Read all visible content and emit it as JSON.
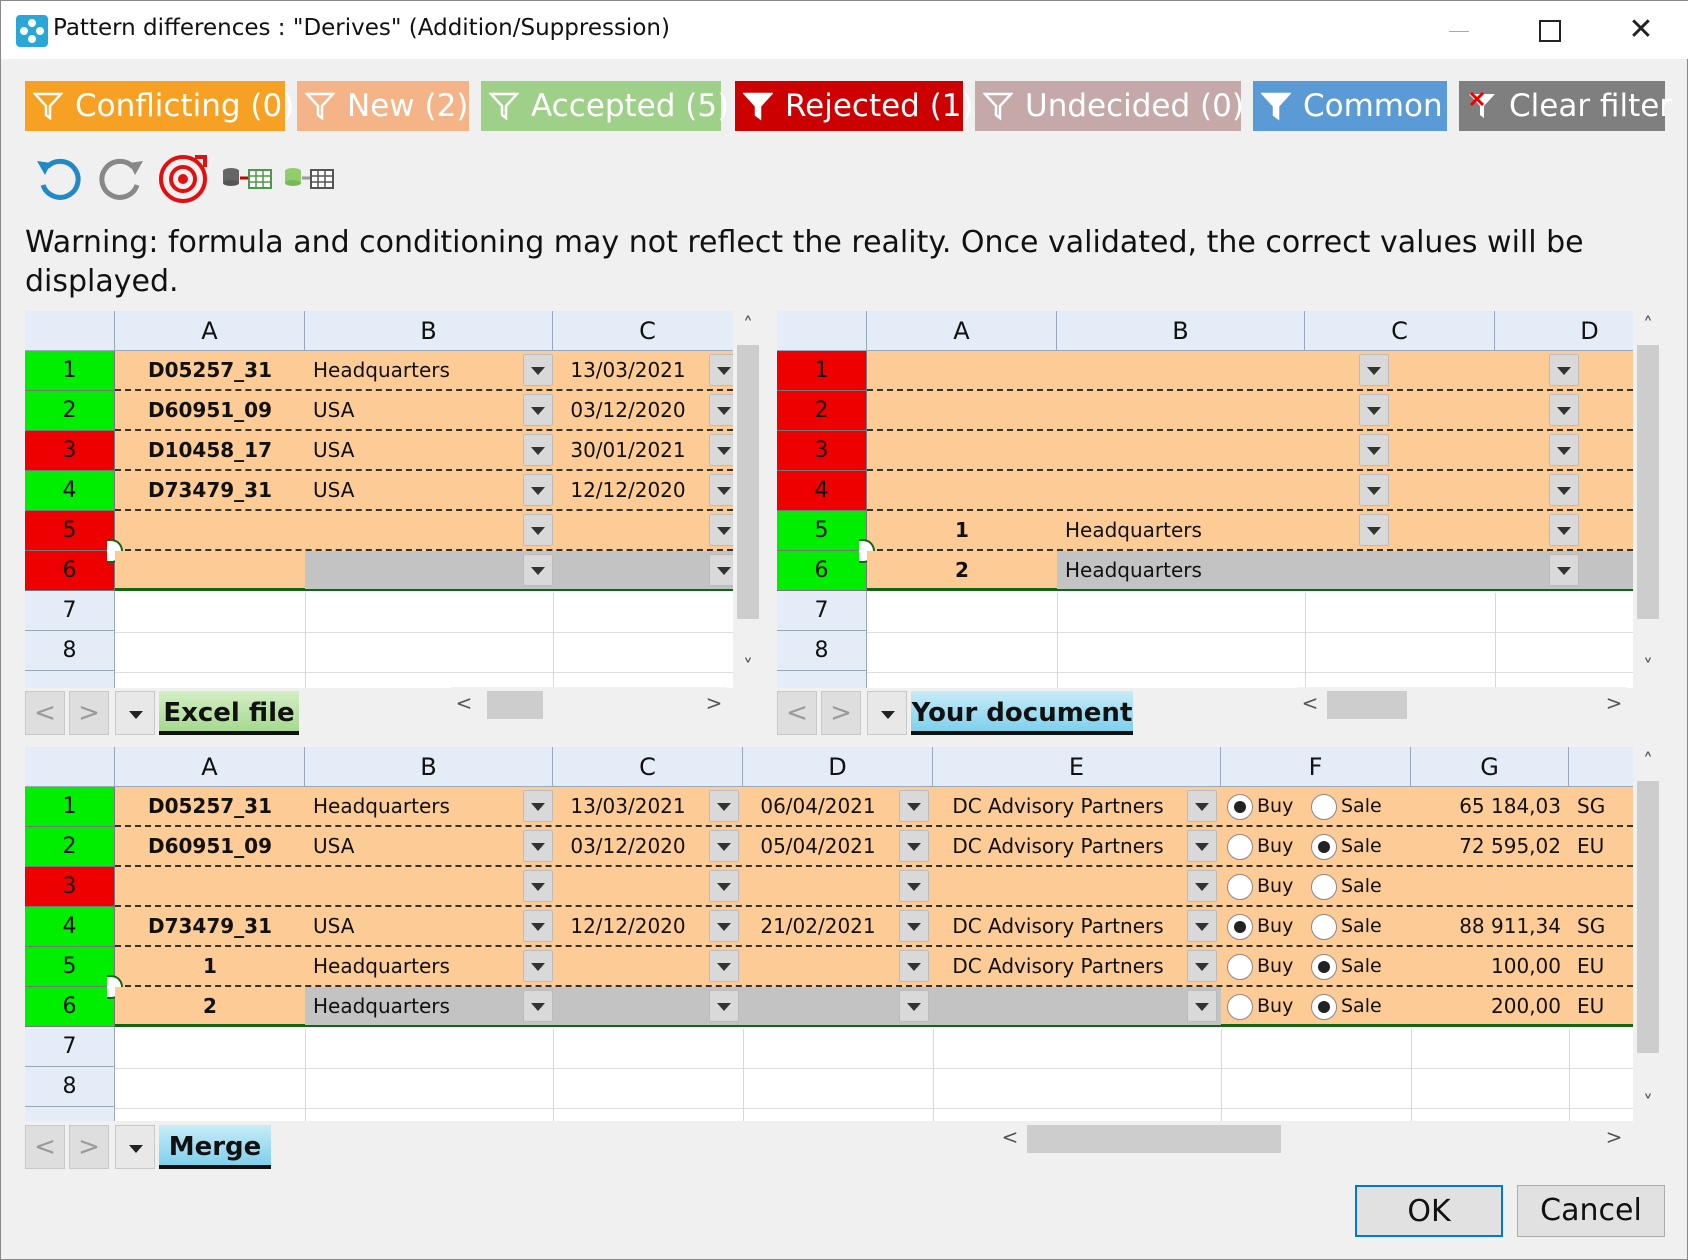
{
  "window": {
    "title": "Pattern differences : \"Derives\" (Addition/Suppression)"
  },
  "filters": [
    {
      "label": "Conflicting (0)",
      "color": "#f6a024"
    },
    {
      "label": "New (2)",
      "color": "#f5b488"
    },
    {
      "label": "Accepted (5)",
      "color": "#9fd089"
    },
    {
      "label": "Rejected (1)",
      "color": "#cc0000"
    },
    {
      "label": "Undecided (0)",
      "color": "#c4a9a8"
    },
    {
      "label": "Common",
      "color": "#5b9bd5"
    },
    {
      "label": "Clear filter",
      "color": "#7f7f7f"
    }
  ],
  "toolbar": {
    "icons": [
      "undo-icon",
      "redo-icon",
      "reset-icon",
      "db-to-sheet-icon",
      "db-to-sheet-alt-icon"
    ]
  },
  "warning": "Warning: formula and conditioning may not reflect the reality. Once validated, the correct values will be displayed.",
  "excel": {
    "tab": "Excel file",
    "columns": [
      "A",
      "B",
      "C"
    ],
    "row_numbers": [
      "1",
      "2",
      "3",
      "4",
      "5",
      "6",
      "7",
      "8"
    ],
    "rows": [
      [
        "D05257_31",
        "Headquarters",
        "13/03/2021"
      ],
      [
        "D60951_09",
        "USA",
        "03/12/2020"
      ],
      [
        "D10458_17",
        "USA",
        "30/01/2021"
      ],
      [
        "D73479_31",
        "USA",
        "12/12/2020"
      ],
      [
        "",
        "",
        ""
      ],
      [
        "",
        "",
        ""
      ]
    ]
  },
  "document": {
    "tab": "Your document",
    "columns": [
      "A",
      "B",
      "C",
      "D"
    ],
    "row_numbers": [
      "1",
      "2",
      "3",
      "4",
      "5",
      "6",
      "7",
      "8"
    ],
    "rows": [
      [
        "",
        "",
        ""
      ],
      [
        "",
        "",
        ""
      ],
      [
        "",
        "",
        ""
      ],
      [
        "",
        "",
        ""
      ],
      [
        "1",
        "Headquarters",
        ""
      ],
      [
        "2",
        "Headquarters",
        ""
      ]
    ]
  },
  "merge": {
    "tab": "Merge",
    "columns": [
      "A",
      "B",
      "C",
      "D",
      "E",
      "F",
      "G"
    ],
    "row_numbers": [
      "1",
      "2",
      "3",
      "4",
      "5",
      "6",
      "7",
      "8"
    ],
    "radio_labels": {
      "buy": "Buy",
      "sale": "Sale"
    },
    "rows": [
      {
        "a": "D05257_31",
        "b": "Headquarters",
        "c": "13/03/2021",
        "d": "06/04/2021",
        "e": "DC Advisory Partners",
        "side": "buy",
        "g": "65 184,03",
        "h": "SG"
      },
      {
        "a": "D60951_09",
        "b": "USA",
        "c": "03/12/2020",
        "d": "05/04/2021",
        "e": "DC Advisory Partners",
        "side": "sale",
        "g": "72 595,02",
        "h": "EU"
      },
      {
        "a": "",
        "b": "",
        "c": "",
        "d": "",
        "e": "",
        "side": "none",
        "g": "",
        "h": ""
      },
      {
        "a": "D73479_31",
        "b": "USA",
        "c": "12/12/2020",
        "d": "21/02/2021",
        "e": "DC Advisory Partners",
        "side": "buy",
        "g": "88 911,34",
        "h": "SG"
      },
      {
        "a": "1",
        "b": "Headquarters",
        "c": "",
        "d": "",
        "e": "DC Advisory Partners",
        "side": "sale",
        "g": "100,00",
        "h": "EU"
      },
      {
        "a": "2",
        "b": "Headquarters",
        "c": "",
        "d": "",
        "e": "",
        "side": "sale",
        "g": "200,00",
        "h": "EU"
      }
    ]
  },
  "buttons": {
    "ok": "OK",
    "cancel": "Cancel"
  },
  "colors": {
    "accepted_row": "#00ee00",
    "rejected_row": "#ee0000",
    "changed_cell": "#fccb96"
  }
}
